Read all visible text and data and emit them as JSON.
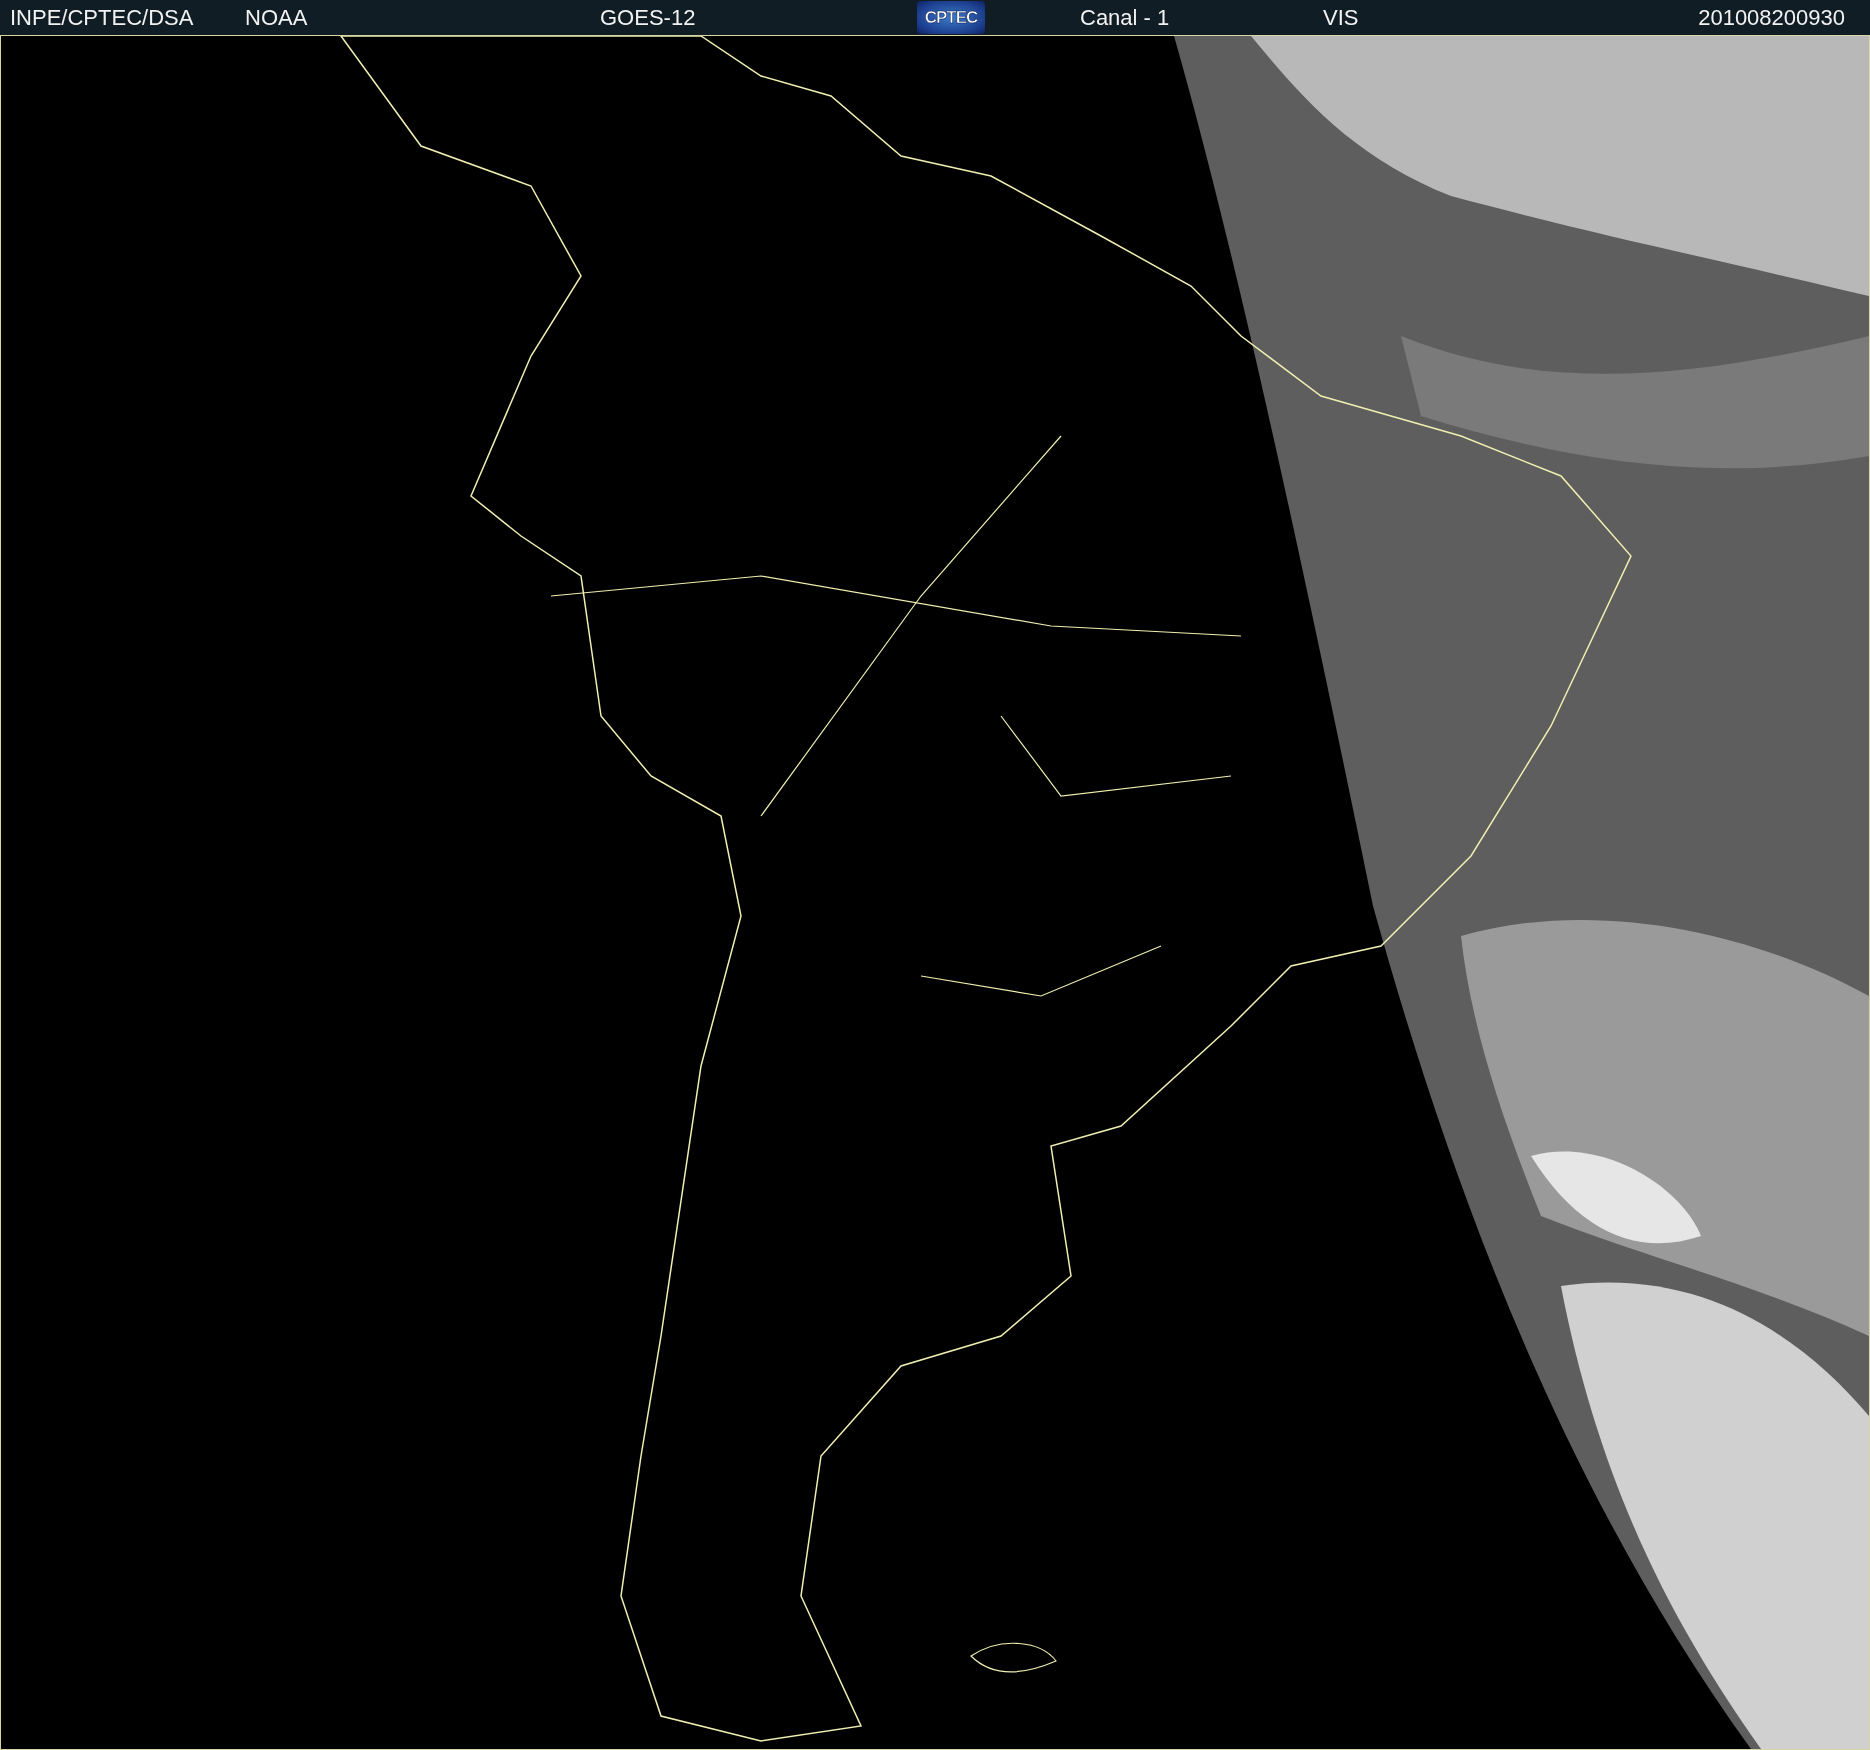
{
  "header": {
    "source": "INPE/CPTEC/DSA",
    "agency": "NOAA",
    "satellite": "GOES-12",
    "logo": "CPTEC",
    "channel": "Canal - 1",
    "band": "VIS",
    "timestamp": "201008200930"
  }
}
